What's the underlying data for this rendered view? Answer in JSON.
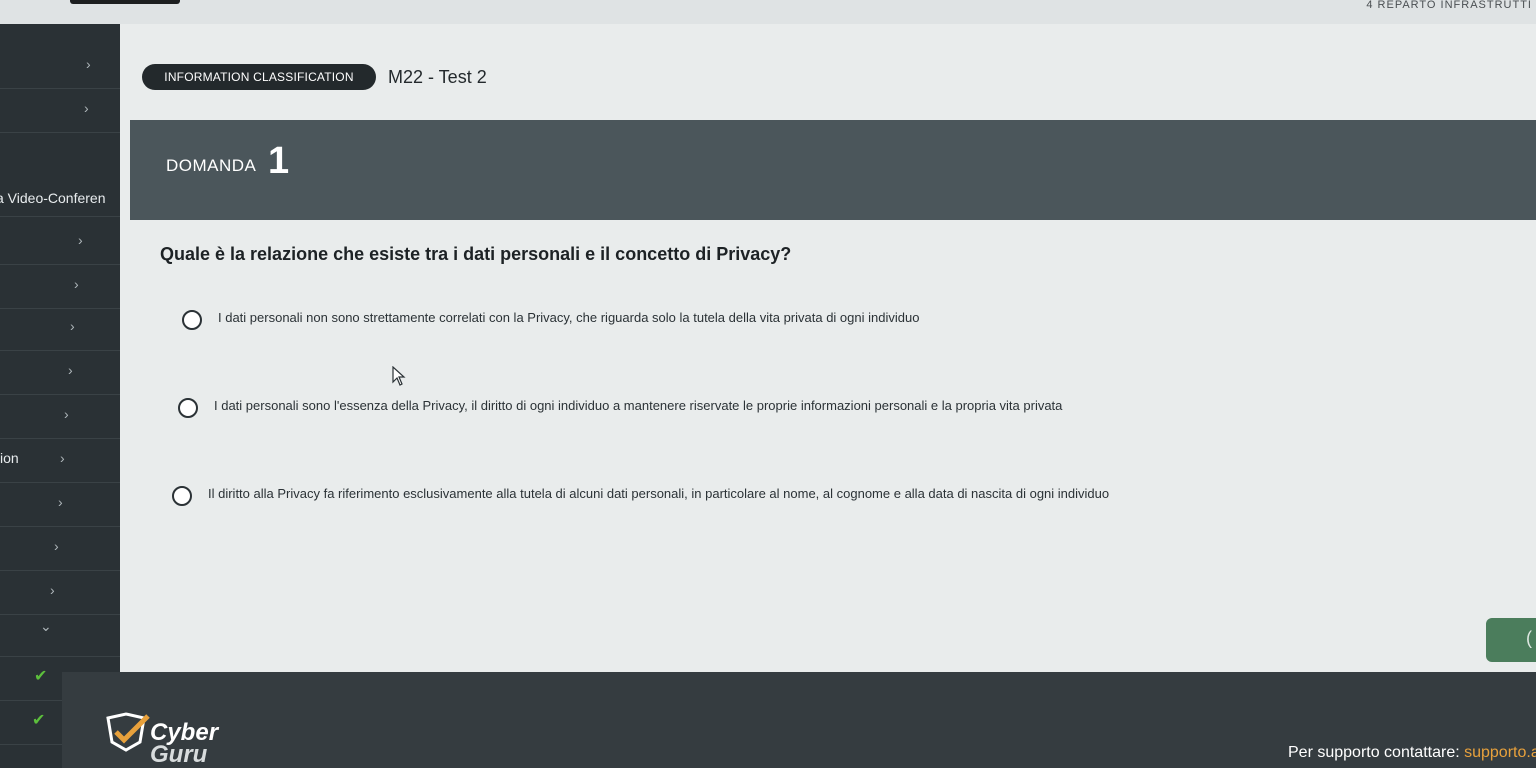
{
  "topbar": {
    "right_text": "4 REPARTO INFRASTRUTTI"
  },
  "sidebar": {
    "partial_label_1": "a Video-Conferen",
    "partial_label_2": "ion",
    "chevron": "›",
    "chevron_down": "⌄",
    "check": "✔",
    "check_color": "#5cbf3c"
  },
  "header": {
    "classification": "INFORMATION CLASSIFICATION",
    "test_title": "M22 - Test 2"
  },
  "question_block": {
    "label": "DOMANDA",
    "number": "1",
    "question": "Quale è la relazione che esiste tra i dati personali e il concetto di Privacy?",
    "options": [
      "I dati personali non sono strettamente correlati con la Privacy, che riguarda solo la tutela della vita privata di ogni individuo",
      "I dati personali sono l'essenza della Privacy, il diritto di ogni individuo a mantenere riservate le proprie informazioni personali e la propria vita privata",
      "Il diritto alla Privacy fa riferimento esclusivamente alla tutela di alcuni dati personali, in particolare al nome, al cognome e alla data di nascita di ogni individuo"
    ]
  },
  "next_button": {
    "glyph": "(",
    "color": "#4b7d5c"
  },
  "footer": {
    "brand_line1": "Cyber",
    "brand_line2": "Guru",
    "support_text": "Per supporto contattare: ",
    "support_link": "supporto.a",
    "accent": "#e8a13c"
  }
}
